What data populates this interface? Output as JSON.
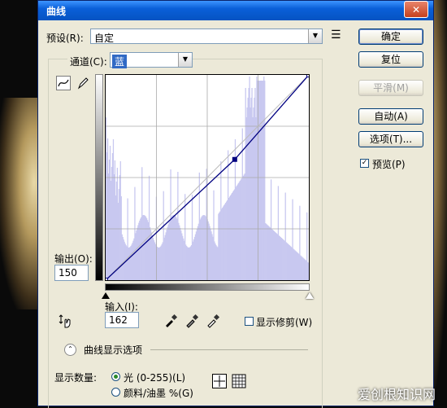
{
  "window": {
    "title": "曲线",
    "close_glyph": "✕"
  },
  "preset": {
    "label": "预设(R):",
    "value": "自定",
    "menu_glyph": "☰"
  },
  "channel": {
    "label": "通道(C):",
    "value": "蓝"
  },
  "buttons": {
    "ok": "确定",
    "reset": "复位",
    "smooth": "平滑(M)",
    "auto": "自动(A)",
    "options": "选项(T)..."
  },
  "preview": {
    "label": "预览(P)",
    "checked": true
  },
  "output": {
    "label": "输出(O):",
    "value": "150"
  },
  "input": {
    "label": "输入(I):",
    "value": "162"
  },
  "show_clipping": {
    "label": "显示修剪(W)",
    "checked": false
  },
  "curve_display_options": {
    "label": "曲线显示选项"
  },
  "show_amount": {
    "label": "显示数量:",
    "options": [
      {
        "label": "光 (0-255)(L)",
        "selected": true
      },
      {
        "label": "颜料/油墨 %(G)",
        "selected": false
      }
    ]
  },
  "watermark": "爱创根知识网",
  "chart_data": {
    "type": "line",
    "xlim": [
      0,
      255
    ],
    "ylim": [
      0,
      255
    ],
    "grid": true,
    "grid_divisions": 4,
    "curve_points": [
      [
        0,
        0
      ],
      [
        162,
        150
      ],
      [
        255,
        255
      ]
    ],
    "selected_point": [
      162,
      150
    ],
    "histogram_color": "#c8c8f0",
    "curve_color": "#000080"
  }
}
